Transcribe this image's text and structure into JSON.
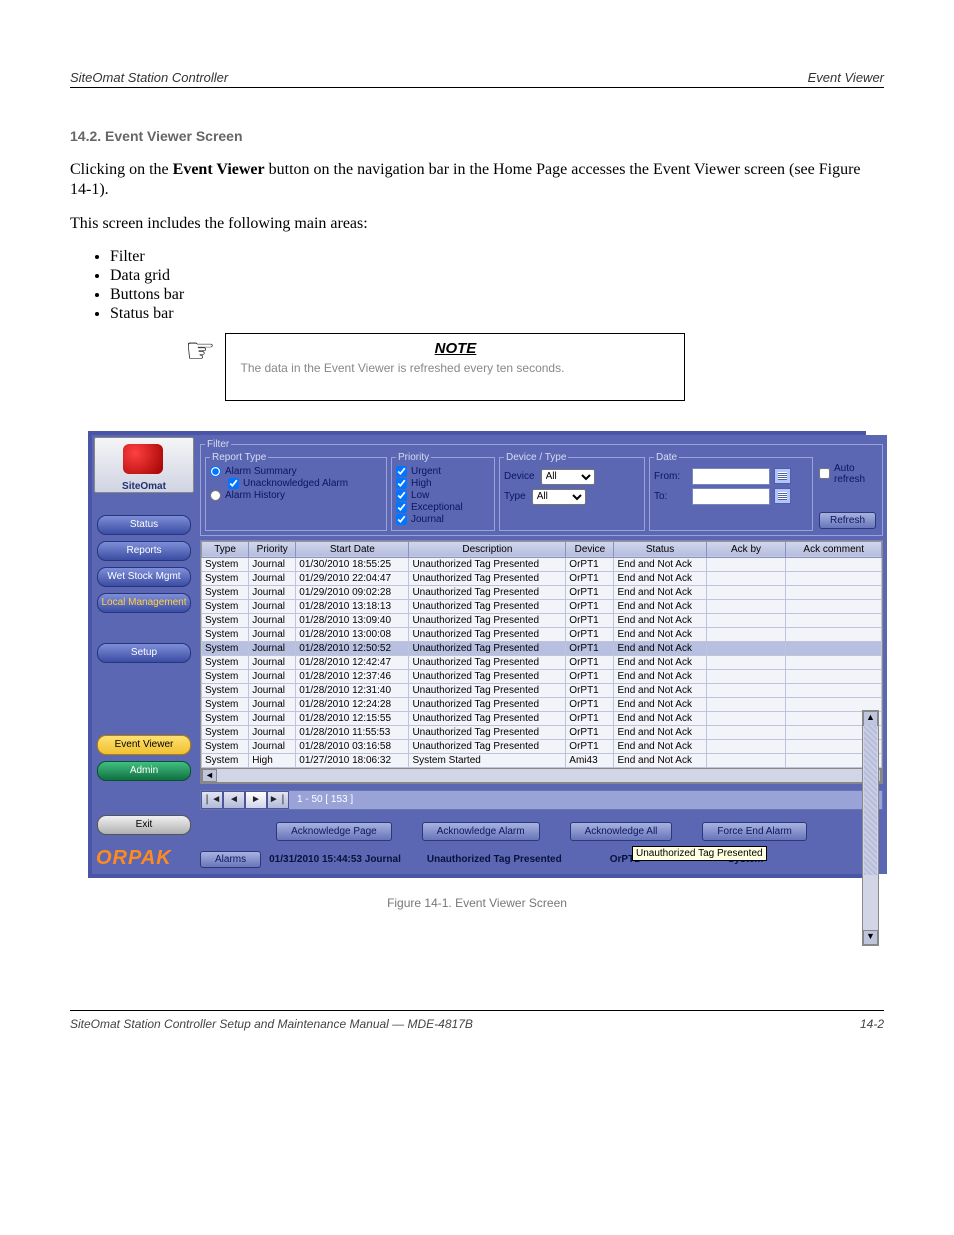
{
  "doc_header": {
    "left": "SiteOmat Station Controller",
    "right": "Event Viewer"
  },
  "section_heading": "14.2.  Event Viewer Screen",
  "para1_a": "Clicking on the ",
  "para1_b": "Event Viewer",
  "para1_c": " button on the navigation bar in the Home Page accesses the Event Viewer screen (see Figure 14-1).",
  "para2": "This screen includes the following main areas:",
  "bullets": [
    "Filter",
    "Data grid",
    "Buttons bar",
    "Status bar"
  ],
  "note_title": "NOTE",
  "note_text": "The data in the Event Viewer is refreshed every ten seconds.",
  "app": {
    "logo_label": "SiteOmat",
    "nav": {
      "status": "Status",
      "reports": "Reports",
      "wetstock": "Wet Stock Mgmt",
      "localmgmt": "Local Management",
      "setup": "Setup",
      "eventviewer": "Event Viewer",
      "admin": "Admin",
      "exit": "Exit"
    },
    "brand": "ORPAK",
    "filter": {
      "legend": "Filter",
      "report_legend": "Report Type",
      "alarm_summary": "Alarm Summary",
      "unack": "Unacknowledged Alarm",
      "alarm_history": "Alarm History",
      "priority_legend": "Priority",
      "urgent": "Urgent",
      "high": "High",
      "low": "Low",
      "exceptional": "Exceptional",
      "journal": "Journal",
      "devtype_legend": "Device / Type",
      "device_label": "Device",
      "type_label": "Type",
      "all": "All",
      "date_legend": "Date",
      "from": "From:",
      "to": "To:",
      "auto_refresh": "Auto refresh",
      "refresh": "Refresh"
    },
    "grid": {
      "headers": [
        "Type",
        "Priority",
        "Start Date",
        "Description",
        "Device",
        "Status",
        "Ack by",
        "Ack comment"
      ],
      "rows": [
        {
          "type": "System",
          "priority": "Journal",
          "date": "01/30/2010 18:55:25",
          "desc": "Unauthorized Tag Presented",
          "device": "OrPT1",
          "status": "End and Not Ack",
          "ackby": "",
          "cmt": ""
        },
        {
          "type": "System",
          "priority": "Journal",
          "date": "01/29/2010 22:04:47",
          "desc": "Unauthorized Tag Presented",
          "device": "OrPT1",
          "status": "End and Not Ack",
          "ackby": "",
          "cmt": ""
        },
        {
          "type": "System",
          "priority": "Journal",
          "date": "01/29/2010 09:02:28",
          "desc": "Unauthorized Tag Presented",
          "device": "OrPT1",
          "status": "End and Not Ack",
          "ackby": "",
          "cmt": ""
        },
        {
          "type": "System",
          "priority": "Journal",
          "date": "01/28/2010 13:18:13",
          "desc": "Unauthorized Tag Presented",
          "device": "OrPT1",
          "status": "End and Not Ack",
          "ackby": "",
          "cmt": ""
        },
        {
          "type": "System",
          "priority": "Journal",
          "date": "01/28/2010 13:09:40",
          "desc": "Unauthorized Tag Presented",
          "device": "OrPT1",
          "status": "End and Not Ack",
          "ackby": "",
          "cmt": ""
        },
        {
          "type": "System",
          "priority": "Journal",
          "date": "01/28/2010 13:00:08",
          "desc": "Unauthorized Tag Presented",
          "device": "OrPT1",
          "status": "End and Not Ack",
          "ackby": "",
          "cmt": ""
        },
        {
          "type": "System",
          "priority": "Journal",
          "date": "01/28/2010 12:50:52",
          "desc": "Unauthorized Tag Presented",
          "device": "OrPT1",
          "status": "End and Not Ack",
          "ackby": "",
          "cmt": "",
          "sel": true
        },
        {
          "type": "System",
          "priority": "Journal",
          "date": "01/28/2010 12:42:47",
          "desc": "Unauthorized Tag Presented",
          "device": "OrPT1",
          "status": "End and Not Ack",
          "ackby": "",
          "cmt": "",
          "tooltip": "Unauthorized Tag Presented"
        },
        {
          "type": "System",
          "priority": "Journal",
          "date": "01/28/2010 12:37:46",
          "desc": "Unauthorized Tag Presented",
          "device": "OrPT1",
          "status": "End and Not Ack",
          "ackby": "",
          "cmt": ""
        },
        {
          "type": "System",
          "priority": "Journal",
          "date": "01/28/2010 12:31:40",
          "desc": "Unauthorized Tag Presented",
          "device": "OrPT1",
          "status": "End and Not Ack",
          "ackby": "",
          "cmt": ""
        },
        {
          "type": "System",
          "priority": "Journal",
          "date": "01/28/2010 12:24:28",
          "desc": "Unauthorized Tag Presented",
          "device": "OrPT1",
          "status": "End and Not Ack",
          "ackby": "",
          "cmt": ""
        },
        {
          "type": "System",
          "priority": "Journal",
          "date": "01/28/2010 12:15:55",
          "desc": "Unauthorized Tag Presented",
          "device": "OrPT1",
          "status": "End and Not Ack",
          "ackby": "",
          "cmt": ""
        },
        {
          "type": "System",
          "priority": "Journal",
          "date": "01/28/2010 11:55:53",
          "desc": "Unauthorized Tag Presented",
          "device": "OrPT1",
          "status": "End and Not Ack",
          "ackby": "",
          "cmt": ""
        },
        {
          "type": "System",
          "priority": "Journal",
          "date": "01/28/2010 03:16:58",
          "desc": "Unauthorized Tag Presented",
          "device": "OrPT1",
          "status": "End and Not Ack",
          "ackby": "",
          "cmt": ""
        },
        {
          "type": "System",
          "priority": "High",
          "date": "01/27/2010 18:06:32",
          "desc": "System Started",
          "device": "Ami43",
          "status": "End and Not Ack",
          "ackby": "",
          "cmt": ""
        }
      ],
      "pager_label": "1 - 50  [ 153 ]"
    },
    "ack": {
      "page": "Acknowledge Page",
      "alarm": "Acknowledge Alarm",
      "all": "Acknowledge All",
      "forceend": "Force End Alarm"
    },
    "status": {
      "alarms_btn": "Alarms",
      "datetime": "01/31/2010 15:44:53 Journal",
      "desc": "Unauthorized Tag Presented",
      "device": "OrPT1",
      "type": "System"
    }
  },
  "figure_caption": "Figure 14-1. Event Viewer Screen",
  "footer": {
    "left": "SiteOmat Station Controller Setup and Maintenance Manual — MDE-4817B",
    "right": "14-2"
  }
}
